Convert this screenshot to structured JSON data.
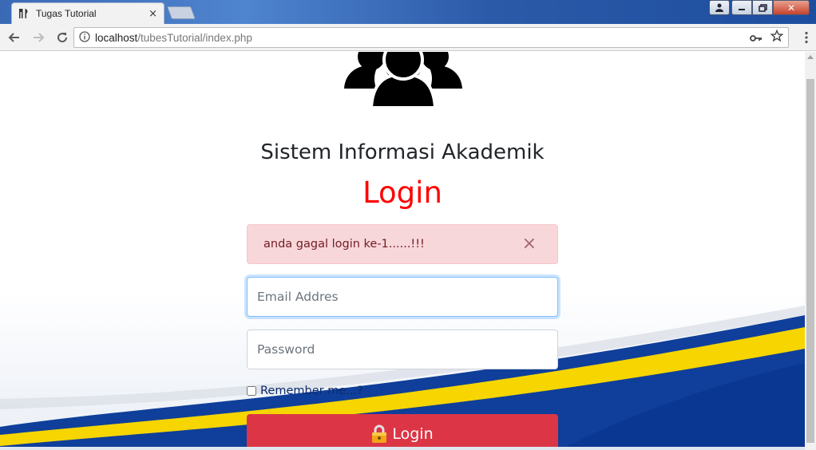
{
  "browser": {
    "tab_title": "Tugas Tutorial",
    "tab_close": "×",
    "url_host": "localhost",
    "url_path": "/tubesTutorial/index.php"
  },
  "page": {
    "app_title": "Sistem Informasi Akademik",
    "login_title": "Login",
    "alert": {
      "message": "anda gagal login ke-1......!!!",
      "close": "×"
    },
    "email": {
      "placeholder": "Email Addres",
      "value": ""
    },
    "password": {
      "placeholder": "Password",
      "value": ""
    },
    "remember_label": "Remember me...?",
    "login_button": "Login"
  },
  "colors": {
    "login_title": "#ff0000",
    "alert_bg": "#f8d7da",
    "button_bg": "#dc3545",
    "swoosh_yellow": "#f6d500",
    "swoosh_blue": "#0f3f9a"
  },
  "icons": {
    "tab_favicon": "utensils-icon",
    "logo": "users-group-icon",
    "info": "info-icon",
    "key": "key-icon",
    "star": "star-icon",
    "lock": "lock-icon"
  }
}
